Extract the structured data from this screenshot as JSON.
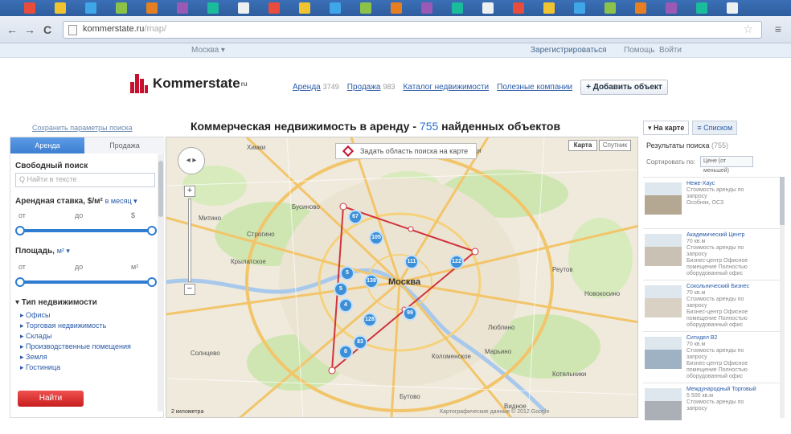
{
  "browser": {
    "url_host": "kommerstate.ru",
    "url_path": "/map/"
  },
  "sitebar": {
    "city": "Москва ▾",
    "register": "Зарегистрироваться",
    "help": "Помощь",
    "login": "Войти"
  },
  "header": {
    "logo_text": "Kommerstate",
    "logo_sup": "ru",
    "nav": [
      {
        "label": "Аренда",
        "count": "3749"
      },
      {
        "label": "Продажа",
        "count": "983"
      },
      {
        "label": "Каталог недвижимости",
        "count": ""
      },
      {
        "label": "Полезные компании",
        "count": ""
      }
    ],
    "add_button": "+ Добавить объект"
  },
  "page": {
    "save_link": "Сохранить параметры поиска",
    "title_prefix": "Коммерческая недвижимость в аренду - ",
    "title_count": "755",
    "title_suffix": " найденных объектов"
  },
  "filters": {
    "tab_rent": "Аренда",
    "tab_sale": "Продажа",
    "free_search_label": "Свободный поиск",
    "free_search_placeholder": "Q Найти в тексте",
    "rate_label": "Арендная ставка, $/м²",
    "rate_unit": "в месяц ▾",
    "from": "от",
    "to": "до",
    "currency": "$",
    "area_label": "Площадь,",
    "area_unit": "м² ▾",
    "area_unit_end": "м²",
    "type_label": "▾ Тип недвижимости",
    "types": [
      "▸ Офисы",
      "▸ Торговая недвижимость",
      "▸ Склады",
      "▸ Производственные помещения",
      "▸ Земля",
      "▸ Гостиница"
    ],
    "find_button": "Найти"
  },
  "map": {
    "banner": "Задать область поиска на карте",
    "type_map": "Карта",
    "type_satellite": "Спутник",
    "city_label": "Москва",
    "clusters": [
      "67",
      "105",
      "5",
      "111",
      "122",
      "5",
      "138",
      "4",
      "128",
      "99",
      "8",
      "83"
    ],
    "labels": [
      "Химки",
      "Мытищи",
      "Бусиново",
      "Новокосино",
      "Бутово",
      "Реутов",
      "Котельники",
      "Люблино",
      "Строгино",
      "Митино",
      "Крылатское",
      "Солнцево",
      "Коломенское",
      "Марьино",
      "Видное"
    ],
    "scale": "2 километра",
    "copyright": "Картографические данные © 2012 Google"
  },
  "results": {
    "tab_map": "▾ На карте",
    "tab_list": "≡ Списком",
    "results_label": "Результаты поиска",
    "results_count": "(755)",
    "sort_label": "Сортировать по:",
    "sort_value": "Цене (от меньшей)",
    "listings": [
      {
        "title": "Неже-Хаус",
        "lines": [
          "Стоимость аренды по",
          "запросу",
          "Особняк, ОСЗ"
        ]
      },
      {
        "title": "Академический Центр",
        "lines": [
          "70 кв.м",
          "Стоимость аренды по",
          "запросу",
          "Бизнес-центр Офисное",
          "помещение Полностью",
          "оборудованный офис"
        ]
      },
      {
        "title": "Сокольнический Бизнес",
        "lines": [
          "70 кв.м",
          "Стоимость аренды по",
          "запросу",
          "Бизнес-центр Офисное",
          "помещение Полностью",
          "оборудованный офис"
        ]
      },
      {
        "title": "Ситидел В2",
        "lines": [
          "70 кв.м",
          "Стоимость аренды по",
          "запросу",
          "Бизнес-центр Офисное",
          "помещение Полностью",
          "оборудованный офис"
        ]
      },
      {
        "title": "Международный Торговый",
        "lines": [
          "5 500 кв.м",
          "Стоимость аренды по",
          "запросу"
        ]
      }
    ]
  }
}
